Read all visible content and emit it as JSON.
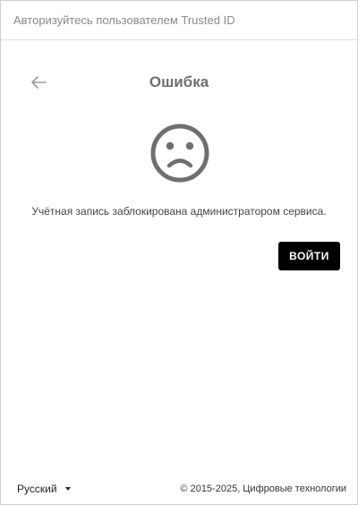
{
  "window": {
    "title": "Авторизуйтесь пользователем Trusted ID"
  },
  "content": {
    "back_icon": "arrow-left-icon",
    "title": "Ошибка",
    "status_icon": "sad-face-icon",
    "message": "Учётная запись заблокирована администратором сервиса.",
    "login_button_label": "ВОЙТИ"
  },
  "footer": {
    "language": "Русский",
    "language_icon": "caret-down-icon",
    "copyright": "© 2015-2025, Цифровые технологии"
  },
  "colors": {
    "primary_button": "#000000",
    "title_text": "#6f6f6f",
    "icon_gray": "#6f6f6f"
  }
}
